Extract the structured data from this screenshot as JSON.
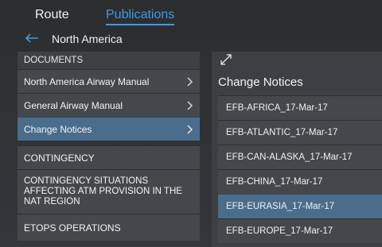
{
  "tabs": [
    "Route",
    "Publications"
  ],
  "breadcrumb": {
    "title": "North America"
  },
  "left": {
    "documents_header": "DOCUMENTS",
    "documents": [
      {
        "label": "North America Airway Manual"
      },
      {
        "label": "General Airway Manual"
      },
      {
        "label": "Change Notices"
      }
    ],
    "contingency_header": "CONTINGENCY",
    "contingency": [
      {
        "label": "CONTINGENCY SITUATIONS AFFECTING ATM PROVISION IN THE NAT REGION"
      },
      {
        "label": "ETOPS OPERATIONS"
      }
    ]
  },
  "right": {
    "title": "Change Notices",
    "notices": [
      "EFB-AFRICA_17-Mar-17",
      "EFB-ATLANTIC_17-Mar-17",
      "EFB-CAN-ALASKA_17-Mar-17",
      "EFB-CHINA_17-Mar-17",
      "EFB-EURASIA_17-Mar-17",
      "EFB-EUROPE_17-Mar-17"
    ],
    "selected_notice": "EFB-EURASIA_17-Mar-17"
  },
  "colors": {
    "accent": "#3f9be6",
    "selected": "#4b6d8c"
  }
}
